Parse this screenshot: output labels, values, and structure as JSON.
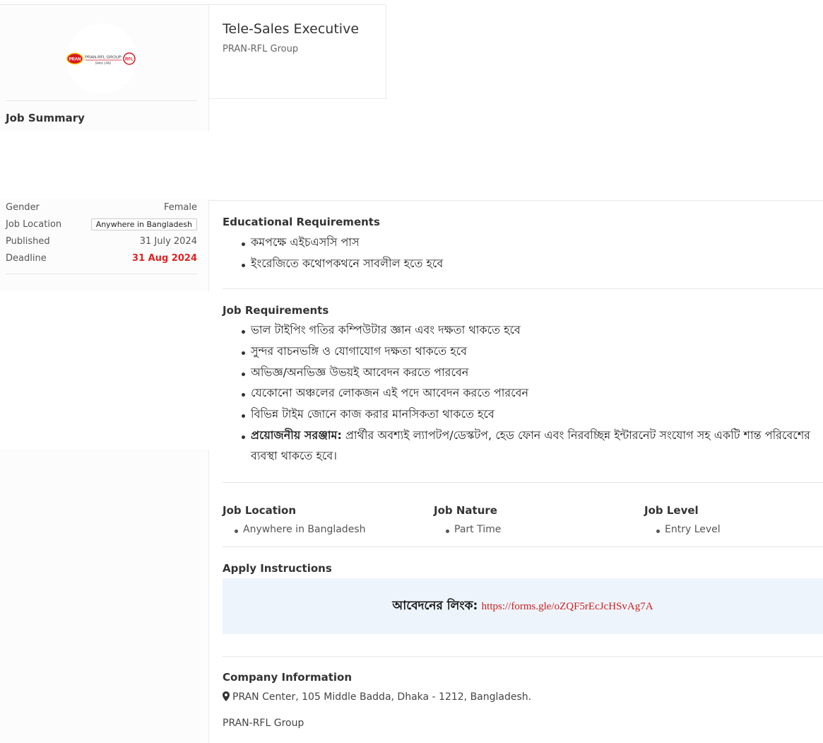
{
  "logo": {
    "brand_text": "PRAN-RFL GROUP",
    "since_text": "Since 1981",
    "pran_text": "PRAN",
    "rfl_text": "RFL",
    "colors": {
      "red": "#d71920",
      "yellow": "#f2c200"
    }
  },
  "job": {
    "title": "Tele-Sales Executive",
    "company": "PRAN-RFL Group"
  },
  "summary": {
    "title": "Job Summary",
    "rows": [
      {
        "label": "Gender",
        "value": "Female"
      },
      {
        "label": "Job Location",
        "value": "Anywhere in Bangladesh"
      },
      {
        "label": "Published",
        "value": "31 July 2024"
      },
      {
        "label": "Deadline",
        "value": "31 Aug 2024"
      }
    ]
  },
  "education": {
    "title": "Educational Requirements",
    "items": [
      "কমপক্ষে এইচএসসি পাস",
      "ইংরেজিতে কথোপকথনে সাবলীল হতে হবে"
    ]
  },
  "requirements": {
    "title": "Job Requirements",
    "items": [
      "ভাল টাইপিং গতির কম্পিউটার জ্ঞান এবং দক্ষতা থাকতে হবে",
      "সুন্দর বাচনভঙ্গি ও যোগাযোগ দক্ষতা থাকতে হবে",
      "অভিজ্ঞ/অনভিজ্ঞ উভয়ই আবেদন করতে পারবেন",
      "যেকোনো অঞ্চলের লোকজন এই পদে আবেদন করতে পারবেন",
      "বিভিন্ন টাইম জোনে কাজ করার মানসিকতা থাকতে হবে"
    ],
    "equipment_label": "প্রয়োজনীয় সরঞ্জাম:",
    "equipment_text": " প্রার্থীর অবশ্যই ল্যাপটপ/ডেস্কটপ, হেড ফোন এবং নিরবচ্ছিন্ন ইন্টারনেট সংযোগ সহ একটি শান্ত পরিবেশের ব্যবস্থা থাকতে হবে।"
  },
  "details": {
    "location_title": "Job Location",
    "location_value": "Anywhere in Bangladesh",
    "nature_title": "Job Nature",
    "nature_value": "Part Time",
    "level_title": "Job Level",
    "level_value": "Entry Level"
  },
  "apply": {
    "title": "Apply Instructions",
    "label": "আবেদনের লিংক:",
    "link": "https://forms.gle/oZQF5rEcJcHSvAg7A"
  },
  "company_info": {
    "title": "Company Information",
    "address": "PRAN Center, 105 Middle Badda, Dhaka - 1212, Bangladesh.",
    "name": "PRAN-RFL Group"
  }
}
